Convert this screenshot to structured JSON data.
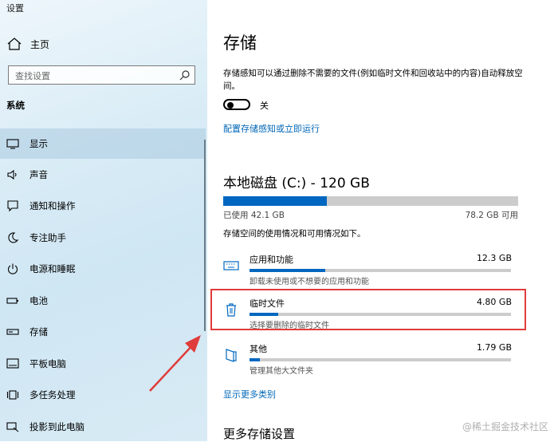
{
  "window": {
    "title": "设置"
  },
  "sidebar": {
    "home_label": "主页",
    "search": {
      "placeholder": "查找设置"
    },
    "group_label": "系统",
    "items": [
      {
        "label": "显示",
        "icon": "monitor-icon"
      },
      {
        "label": "声音",
        "icon": "speaker-icon"
      },
      {
        "label": "通知和操作",
        "icon": "notification-icon"
      },
      {
        "label": "专注助手",
        "icon": "moon-icon"
      },
      {
        "label": "电源和睡眠",
        "icon": "power-icon"
      },
      {
        "label": "电池",
        "icon": "battery-icon"
      },
      {
        "label": "存储",
        "icon": "storage-icon"
      },
      {
        "label": "平板电脑",
        "icon": "tablet-icon"
      },
      {
        "label": "多任务处理",
        "icon": "multitask-icon"
      },
      {
        "label": "投影到此电脑",
        "icon": "project-icon"
      }
    ]
  },
  "main": {
    "title": "存储",
    "description": "存储感知可以通过删除不需要的文件(例如临时文件和回收站中的内容)自动释放空间。",
    "toggle": {
      "state": "off",
      "label": "关"
    },
    "configure_link": "配置存储感知或立即运行",
    "disk": {
      "title": "本地磁盘 (C:) - 120 GB",
      "used_label": "已使用 42.1 GB",
      "free_label": "78.2 GB 可用",
      "used_fraction": 0.35
    },
    "usage_intro": "存储空间的使用情况和可用情况如下。",
    "categories": [
      {
        "name": "应用和功能",
        "size": "12.3 GB",
        "sub": "卸载未使用或不想要的应用和功能",
        "fraction": 0.29,
        "icon": "keyboard-icon"
      },
      {
        "name": "临时文件",
        "size": "4.80 GB",
        "sub": "选择要删除的临时文件",
        "fraction": 0.11,
        "icon": "trash-icon"
      },
      {
        "name": "其他",
        "size": "1.79 GB",
        "sub": "管理其他大文件夹",
        "fraction": 0.04,
        "icon": "folder-icon"
      }
    ],
    "show_more_link": "显示更多类别",
    "more_settings_title": "更多存储设置"
  },
  "watermark": "@稀土掘金技术社区",
  "colors": {
    "accent": "#0067c0",
    "link": "#0067b8",
    "highlight": "#e03c3c"
  }
}
